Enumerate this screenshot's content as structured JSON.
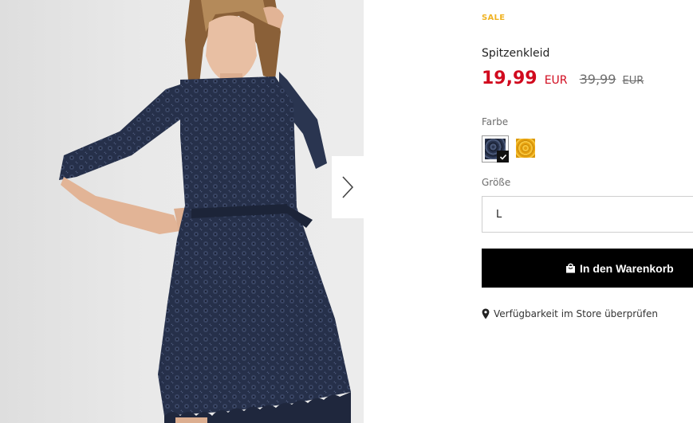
{
  "product": {
    "badge": "SALE",
    "name": "Spitzenkleid",
    "price": {
      "current": "19,99",
      "current_currency": "EUR",
      "old": "39,99",
      "old_currency": "EUR"
    },
    "colors": {
      "label": "Farbe",
      "options": [
        {
          "name": "navy",
          "hex": "#2a3550",
          "selected": true
        },
        {
          "name": "yellow",
          "hex": "#f0b323",
          "selected": false
        }
      ]
    },
    "size": {
      "label": "Größe",
      "selected": "L"
    },
    "add_to_cart_label": "In den Warenkorb",
    "store_availability_label": "Verfügbarkeit im Store überprüfen"
  },
  "gallery": {
    "next_icon": "chevron-right-icon"
  },
  "colors": {
    "sale": "#f0b323",
    "price": "#d10a1e",
    "button": "#000000"
  }
}
